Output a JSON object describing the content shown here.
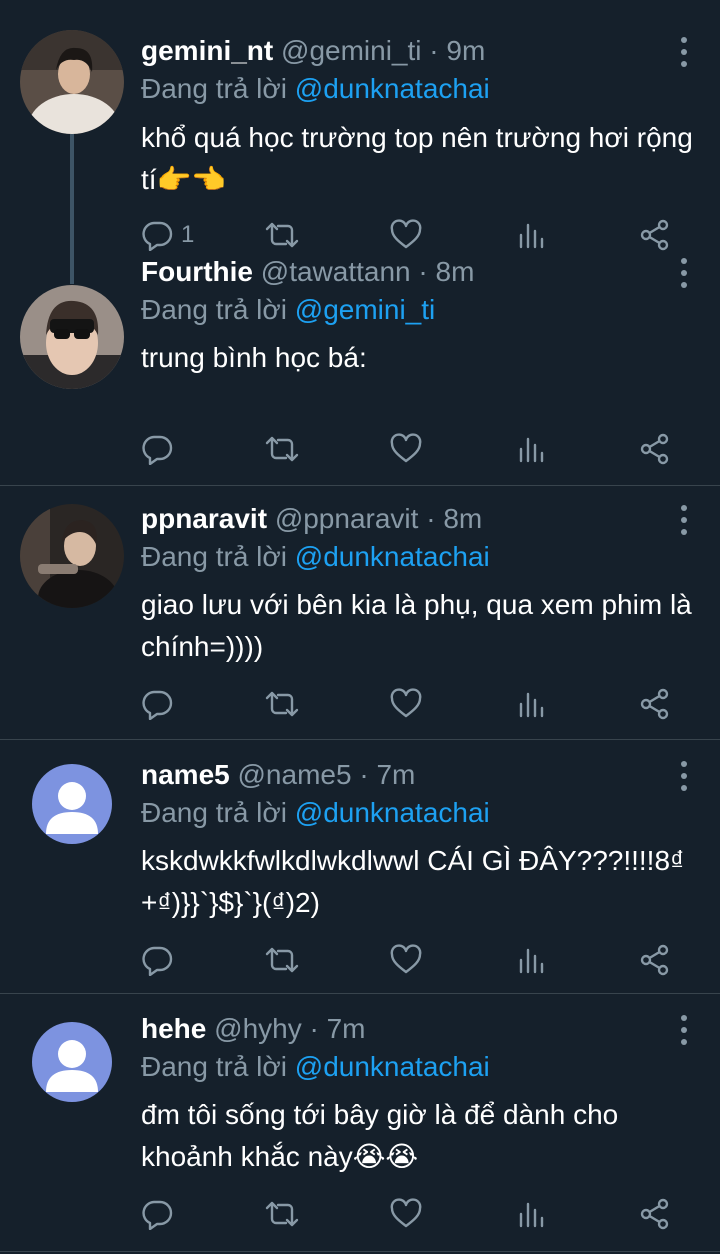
{
  "tweets": [
    {
      "name": "gemini_nt",
      "handle": "@gemini_ti",
      "time": "9m",
      "reply_prefix": "Đang trả lời",
      "reply_to": "@dunknatachai",
      "text": "khổ quá học trường top nên trường hơi rộng tí👉👈",
      "reply_count": "1"
    },
    {
      "name": "Fourthie",
      "handle": "@tawattann",
      "time": "8m",
      "reply_prefix": "Đang trả lời",
      "reply_to": "@gemini_ti",
      "text": "trung bình học bá:",
      "reply_count": ""
    },
    {
      "name": "ppnaravit",
      "handle": "@ppnaravit",
      "time": "8m",
      "reply_prefix": "Đang trả lời",
      "reply_to": "@dunknatachai",
      "text": "giao lưu với bên kia là phụ, qua xem phim là chính=))))",
      "reply_count": ""
    },
    {
      "name": "name5",
      "handle": "@name5",
      "time": "7m",
      "reply_prefix": "Đang trả lời",
      "reply_to": "@dunknatachai",
      "text": "kskdwkkfwlkdlwkdlwwl CÁI GÌ ĐÂY???!!!!8₫+₫)}}`}$}`}(₫)2)",
      "reply_count": ""
    },
    {
      "name": "hehe",
      "handle": "@hyhy",
      "time": "7m",
      "reply_prefix": "Đang trả lời",
      "reply_to": "@dunknatachai",
      "text": "đm tôi sống tới bây giờ là để dành cho khoảnh khắc này😭😭",
      "reply_count": ""
    }
  ],
  "separator": "·",
  "colors": {
    "background": "#15202b",
    "secondary_text": "#8899a6",
    "mention": "#1da1f2",
    "divider": "#38444d"
  },
  "icons": [
    "reply-icon",
    "retweet-icon",
    "like-icon",
    "analytics-icon",
    "share-icon",
    "more-vertical-icon"
  ]
}
